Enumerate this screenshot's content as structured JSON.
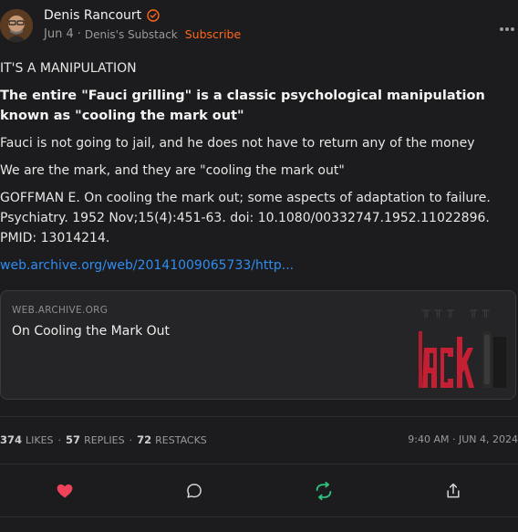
{
  "header": {
    "author_name": "Denis Rancourt",
    "date": "Jun 4",
    "separator": "·",
    "publication": "Denis's Substack",
    "subscribe_label": "Subscribe"
  },
  "post": {
    "line1": "IT'S A MANIPULATION",
    "line2": "The entire \"Fauci grilling\" is a classic psychological manipulation known as \"cooling the mark out\"",
    "line3": "Fauci is not going to jail, and he does not have to return any of the money",
    "line4": "We are the mark, and they are \"cooling the mark out\"",
    "line5": "GOFFMAN E. On cooling the mark out; some aspects of adaptation to failure. Psychiatry. 1952 Nov;15(4):451-63. doi: 10.1080/00332747.1952.11022896. PMID: 13014214.",
    "link_text": "web.archive.org/web/20141009065733/http..."
  },
  "embed": {
    "domain": "WEB.ARCHIVE.ORG",
    "title": "On Cooling the Mark Out"
  },
  "stats": {
    "likes_count": "374",
    "likes_label": "LIKES",
    "replies_count": "57",
    "replies_label": "REPLIES",
    "restacks_count": "72",
    "restacks_label": "RESTACKS",
    "dot": "·",
    "time": "9:40 AM · JUN 4, 2024"
  },
  "colors": {
    "background": "#1c1c1e",
    "accent_subscribe": "#ff6719",
    "link": "#2f8df0",
    "like_active": "#f0435a",
    "restack": "#2ec27e"
  },
  "icons": {
    "verified": "verified-check-icon",
    "more": "more-dots-icon",
    "like": "heart-icon",
    "reply": "comment-bubble-icon",
    "restack": "restack-arrows-icon",
    "share": "share-icon"
  }
}
